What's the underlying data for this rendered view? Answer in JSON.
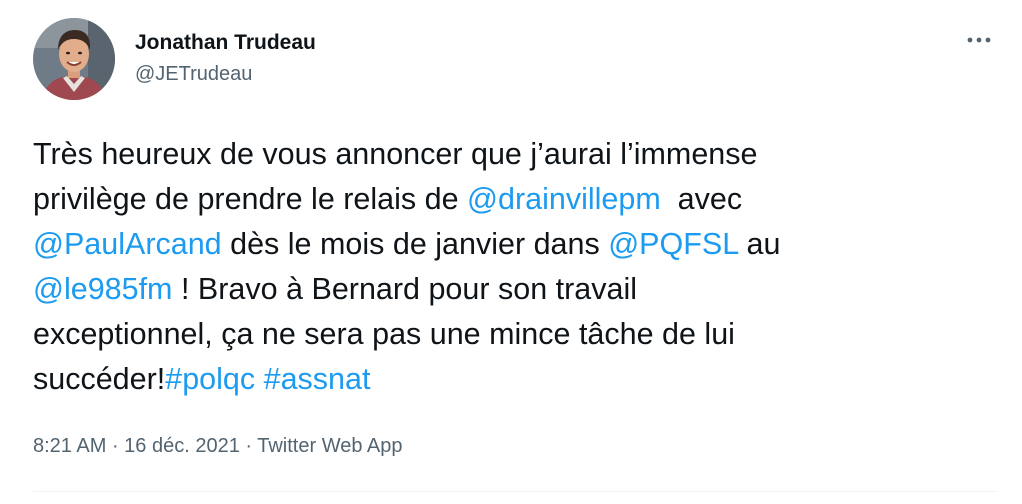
{
  "author": {
    "display_name": "Jonathan Trudeau",
    "handle": "@JETrudeau",
    "avatar_icon": "profile-photo"
  },
  "more_icon": "more-horizontal-icon",
  "tweet": {
    "lines": [
      [
        {
          "type": "text",
          "value": "Très heureux de vous annoncer que j’aurai l’immense"
        }
      ],
      [
        {
          "type": "text",
          "value": "privilège de prendre le relais de "
        },
        {
          "type": "mention",
          "value": "@drainvillepm"
        },
        {
          "type": "text",
          "value": "  avec"
        }
      ],
      [
        {
          "type": "mention",
          "value": "@PaulArcand"
        },
        {
          "type": "text",
          "value": " dès le mois de janvier dans "
        },
        {
          "type": "mention",
          "value": "@PQFSL"
        },
        {
          "type": "text",
          "value": " au"
        }
      ],
      [
        {
          "type": "mention",
          "value": "@le985fm"
        },
        {
          "type": "text",
          "value": " ! Bravo à Bernard pour son travail"
        }
      ],
      [
        {
          "type": "text",
          "value": "exceptionnel, ça ne sera pas une mince tâche de lui"
        }
      ],
      [
        {
          "type": "text",
          "value": "succéder!"
        },
        {
          "type": "hashtag",
          "value": "#polqc"
        },
        {
          "type": "text",
          "value": " "
        },
        {
          "type": "hashtag",
          "value": "#assnat"
        }
      ]
    ]
  },
  "meta": {
    "time": "8:21 AM",
    "separator": " · ",
    "date": "16 déc. 2021",
    "source": "Twitter Web App"
  },
  "colors": {
    "link": "#1d9bf0",
    "secondary_text": "#536471",
    "primary_text": "#0f1419",
    "divider": "#eff3f4"
  }
}
